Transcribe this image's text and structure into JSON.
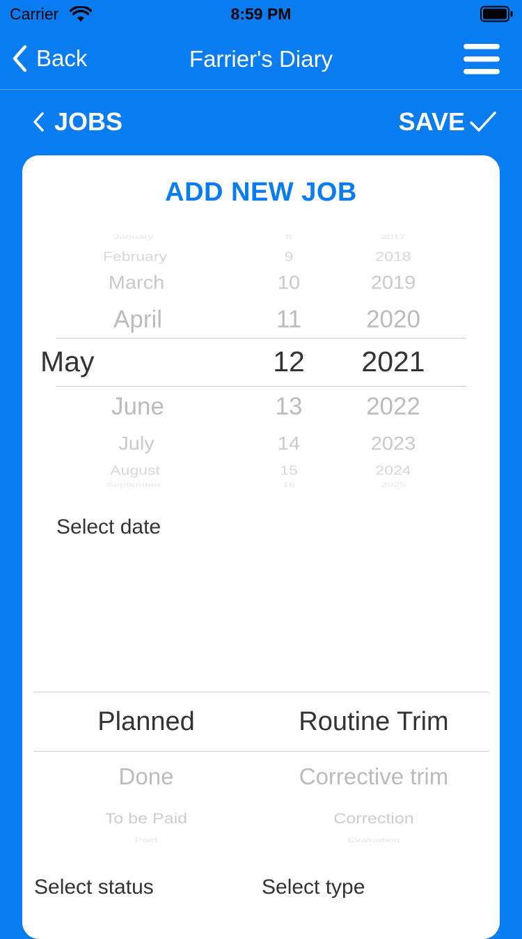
{
  "status_bar": {
    "carrier": "Carrier",
    "time": "8:59 PM"
  },
  "nav": {
    "back_label": "Back",
    "title": "Farrier's Diary"
  },
  "toolbar": {
    "jobs_label": "JOBS",
    "save_label": "SAVE"
  },
  "card": {
    "title": "ADD NEW JOB",
    "date_picker": {
      "months": [
        "January",
        "February",
        "March",
        "April",
        "May",
        "June",
        "July",
        "August",
        "September"
      ],
      "days": [
        "8",
        "9",
        "10",
        "11",
        "12",
        "13",
        "14",
        "15",
        "16"
      ],
      "years": [
        "2017",
        "2018",
        "2019",
        "2020",
        "2021",
        "2022",
        "2023",
        "2024",
        "2025"
      ],
      "selected": {
        "month": "May",
        "day": "12",
        "year": "2021"
      }
    },
    "date_label": "Select date",
    "status_picker": {
      "options": [
        "Planned",
        "Done",
        "To be Paid",
        "Paid"
      ],
      "selected": "Planned"
    },
    "type_picker": {
      "options": [
        "Routine Trim",
        "Corrective trim",
        "Correction",
        "Evaluation"
      ],
      "selected": "Routine Trim"
    },
    "status_label": "Select status",
    "type_label": "Select type"
  },
  "colors": {
    "primary": "#0a7cf2",
    "card": "#ffffff",
    "selected_text": "#333333",
    "faded_text": "#b8b8bc"
  }
}
